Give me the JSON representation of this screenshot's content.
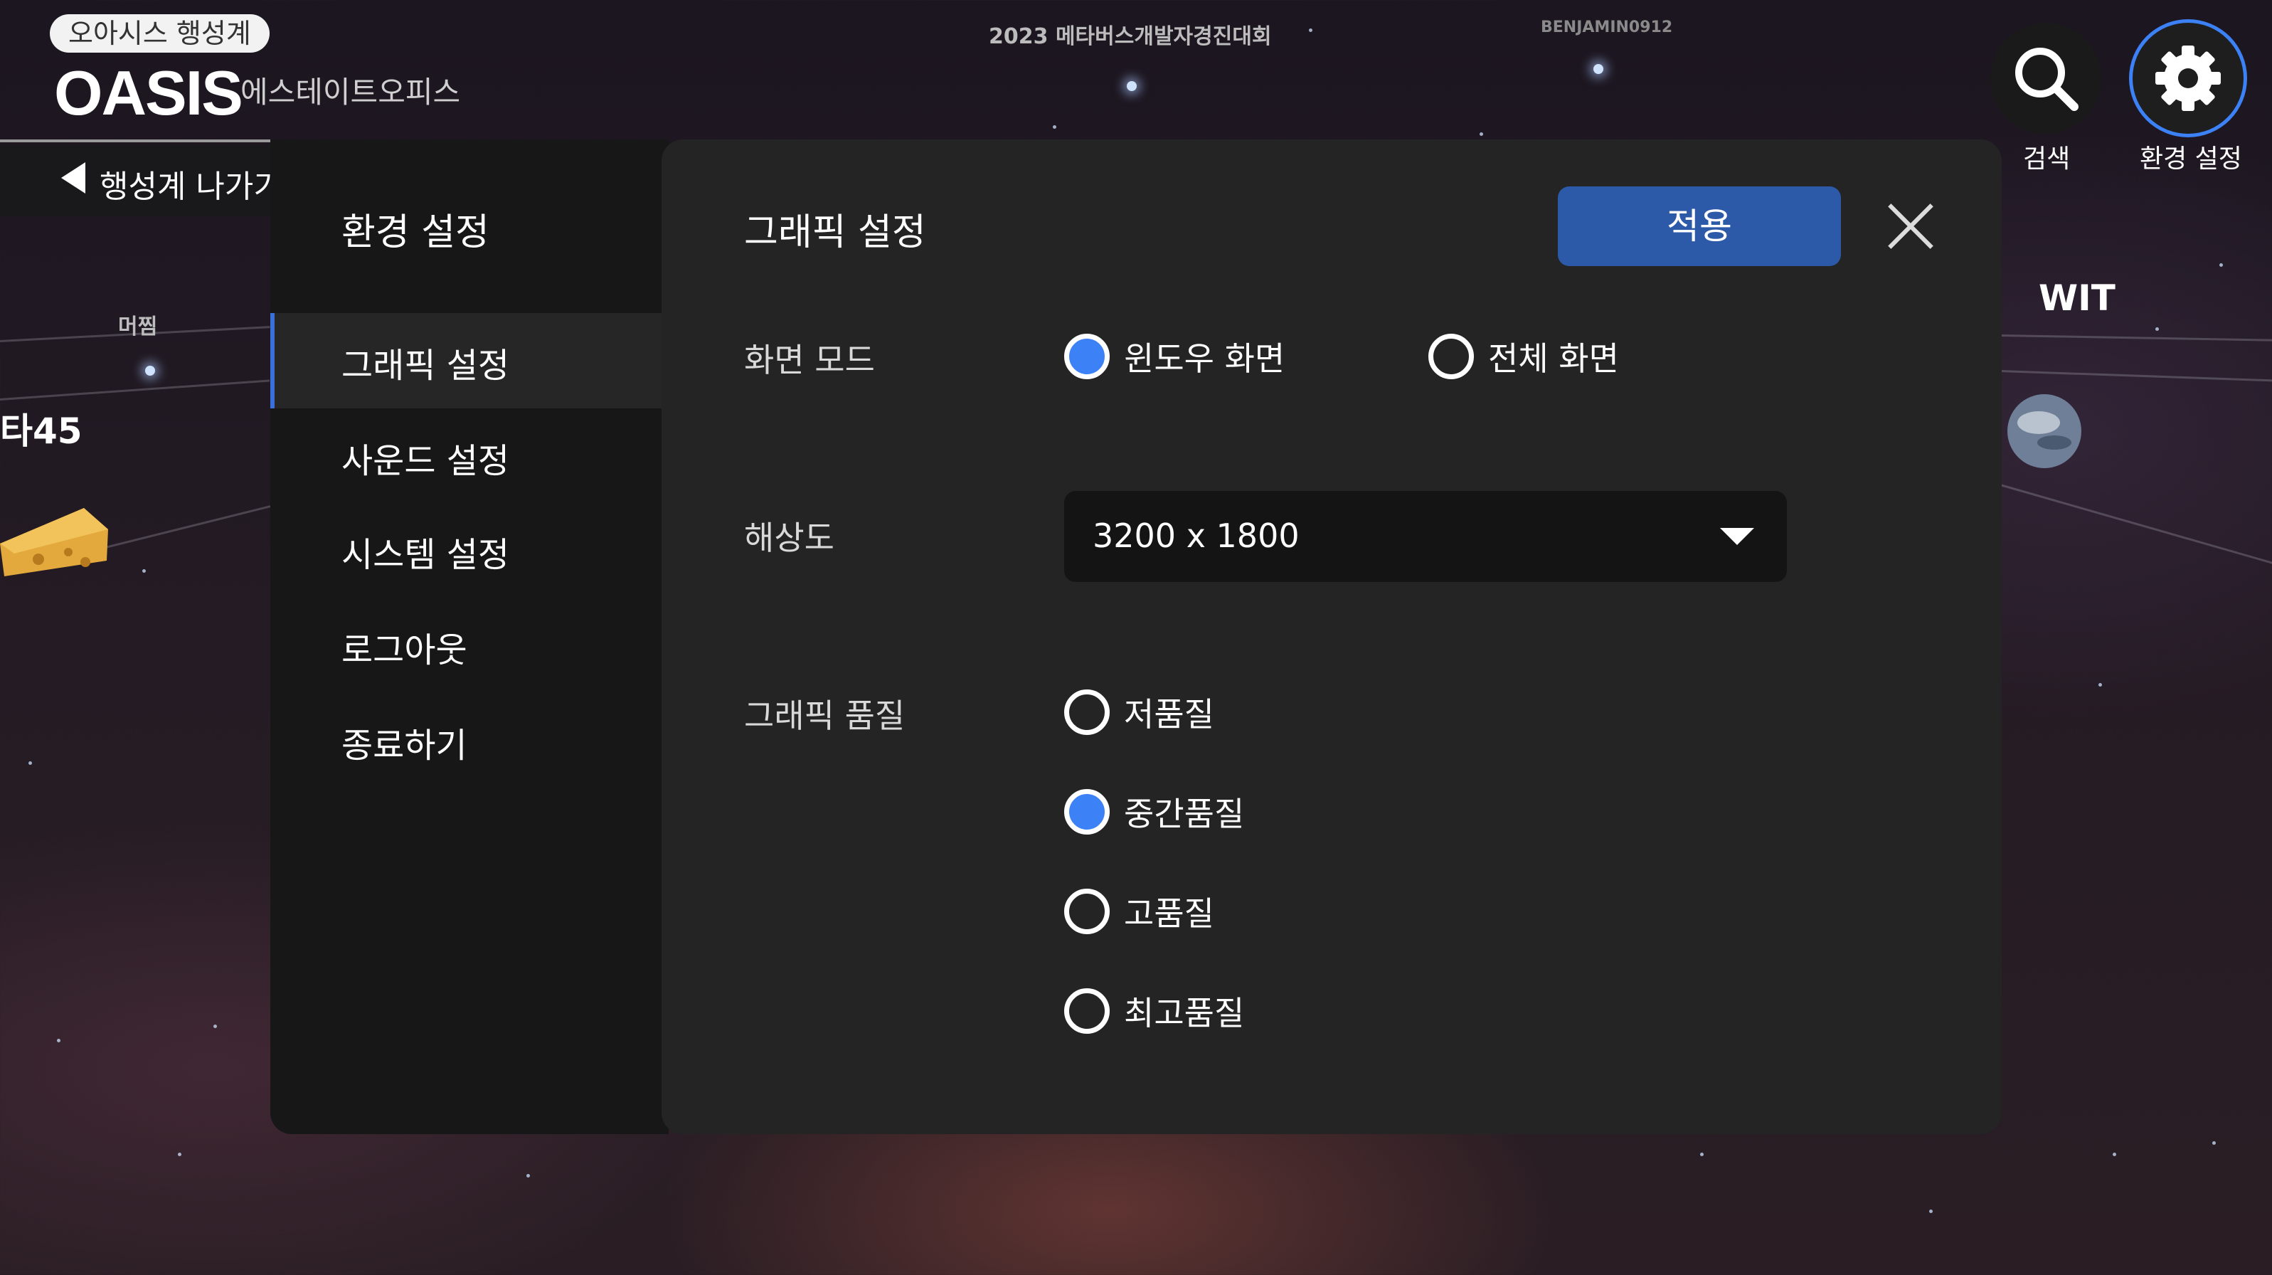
{
  "brand": {
    "pill": "오아시스 행성계",
    "logo": "OASIS",
    "subtitle": "에스테이트오피스",
    "back_label": "행성계 나가기"
  },
  "header": {
    "event": "2023 메타버스개발자경진대회",
    "username": "BENJAMIN0912"
  },
  "top_buttons": {
    "search": {
      "icon": "search-icon",
      "label": "검색"
    },
    "settings": {
      "icon": "gear-icon",
      "label": "환경 설정"
    }
  },
  "planets": {
    "left_small": "머찜",
    "left_big": "타45",
    "right": "WIT"
  },
  "sidebar": {
    "title": "환경 설정",
    "items": [
      {
        "label": "그래픽 설정",
        "selected": true
      },
      {
        "label": "사운드 설정",
        "selected": false
      },
      {
        "label": "시스템 설정",
        "selected": false
      },
      {
        "label": "로그아웃",
        "selected": false
      },
      {
        "label": "종료하기",
        "selected": false
      }
    ]
  },
  "graphics": {
    "title": "그래픽 설정",
    "apply_label": "적용",
    "close_icon": "close-icon",
    "screen_mode": {
      "label": "화면 모드",
      "options": [
        {
          "label": "윈도우 화면",
          "selected": true
        },
        {
          "label": "전체 화면",
          "selected": false
        }
      ]
    },
    "resolution": {
      "label": "해상도",
      "value": "3200 x 1800"
    },
    "quality": {
      "label": "그래픽 품질",
      "options": [
        {
          "label": "저품질",
          "selected": false
        },
        {
          "label": "중간품질",
          "selected": true
        },
        {
          "label": "고품질",
          "selected": false
        },
        {
          "label": "최고품질",
          "selected": false
        }
      ]
    }
  },
  "colors": {
    "accent": "#3c82f6",
    "apply_button": "#2c59a8"
  }
}
